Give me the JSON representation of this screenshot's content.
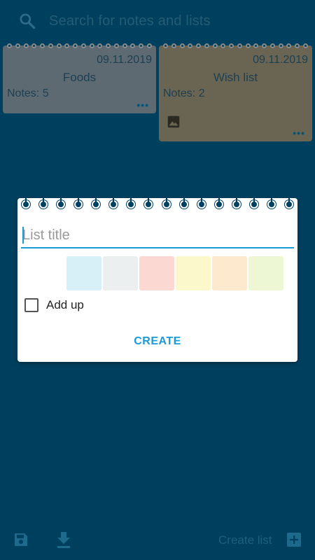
{
  "search": {
    "placeholder": "Search for notes and lists",
    "icon": "search-icon"
  },
  "lists": [
    {
      "date": "09.11.2019",
      "title": "Foods",
      "notes": "Notes: 5",
      "more": "•••",
      "color": "#5e6a71"
    },
    {
      "date": "09.11.2019",
      "title": "Wish list",
      "notes": "Notes: 2",
      "more": "•••",
      "color": "#6a6552",
      "icon": "image-icon"
    }
  ],
  "dialog": {
    "title_placeholder": "List title",
    "title_value": "",
    "swatches": [
      "#d7eff7",
      "#eceff0",
      "#fbd8d2",
      "#fbf9cc",
      "#fde9cd",
      "#eef7d3"
    ],
    "checkbox_label": "Add up",
    "checkbox_checked": false,
    "create_label": "CREATE",
    "accent": "#1a9ad6"
  },
  "bottom_bar": {
    "save_icon": "save-icon",
    "download_icon": "download-icon",
    "create_list_label": "Create list",
    "add_icon": "add-box-icon"
  }
}
